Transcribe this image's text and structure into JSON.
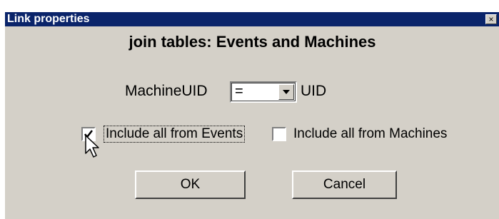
{
  "window": {
    "title": "Link properties",
    "close_glyph": "×"
  },
  "dialog": {
    "heading": "join tables: Events and Machines",
    "left_field": "MachineUID",
    "operator": "=",
    "right_field": "UID",
    "include_left": {
      "label": "Include all from Events",
      "checked": true
    },
    "include_right": {
      "label": "Include all from Machines",
      "checked": false
    },
    "ok_label": "OK",
    "cancel_label": "Cancel"
  },
  "colors": {
    "titlebar": "#0a246a",
    "face": "#d4d0c8"
  },
  "icons": [
    "close-icon",
    "dropdown-arrow-icon",
    "checkmark-icon",
    "mouse-pointer-icon"
  ]
}
